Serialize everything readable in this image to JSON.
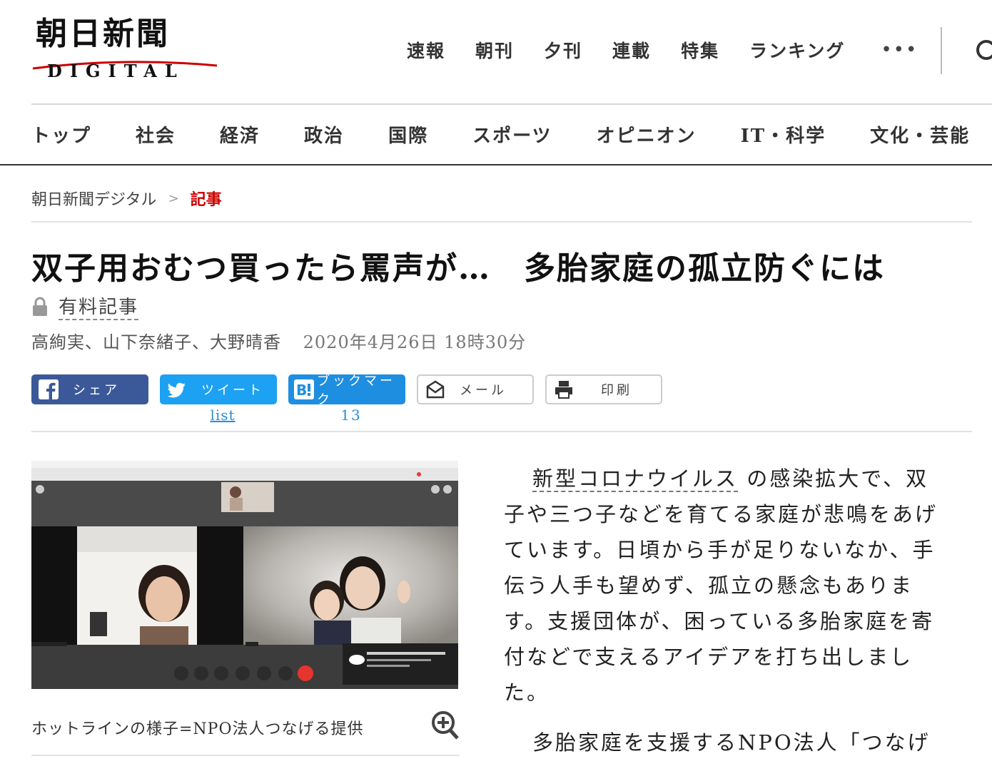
{
  "header": {
    "logo_main": "朝日新聞",
    "logo_sub": "DIGITAL",
    "nav": [
      "速報",
      "朝刊",
      "夕刊",
      "連載",
      "特集",
      "ランキング"
    ],
    "more": "•••"
  },
  "categories": [
    "トップ",
    "社会",
    "経済",
    "政治",
    "国際",
    "スポーツ",
    "オピニオン",
    "IT・科学",
    "文化・芸能"
  ],
  "breadcrumb": {
    "home": "朝日新聞デジタル",
    "sep": ">",
    "current": "記事"
  },
  "article": {
    "title": "双子用おむつ買ったら罵声が…　多胎家庭の孤立防ぐには",
    "paid_label": "有料記事",
    "authors": "高絢実、山下奈緒子、大野晴香",
    "date": "2020年4月26日 18時30分",
    "caption": "ホットラインの様子=NPO法人つなげる提供",
    "body_link": "新型コロナウイルス",
    "body_p1_rest": "の感染拡大で、双子や三つ子などを育てる家庭が悲鳴をあげています。日頃から手が足りないなか、手伝う人手も望めず、孤立の懸念もあります。支援団体が、困っている多胎家庭を寄付などで支えるアイデアを打ち出しました。",
    "body_p2": "多胎家庭を支援するNPO法人「つなげ"
  },
  "share": {
    "facebook": "シェア",
    "twitter": "ツイート",
    "twitter_count": "list",
    "hatena": "ブックマーク",
    "hatena_count": "13",
    "mail": "メール",
    "print": "印刷"
  },
  "colors": {
    "accent_red": "#c00000",
    "facebook": "#3b5998",
    "twitter": "#1da1f2",
    "hatena": "#1e8ee0"
  }
}
